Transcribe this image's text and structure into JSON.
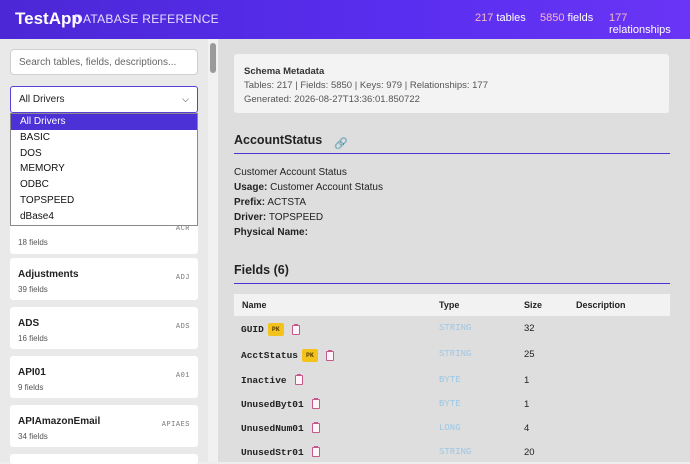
{
  "header": {
    "title": "TestApp",
    "subtitle": "DATABASE REFERENCE",
    "stats": [
      {
        "num": "217",
        "label": "tables"
      },
      {
        "num": "5850",
        "label": "fields"
      },
      {
        "num": "177",
        "label": "relationships"
      }
    ]
  },
  "sidebar": {
    "search_placeholder": "Search tables, fields, descriptions...",
    "driver_selected": "All Drivers",
    "driver_options": [
      "All Drivers",
      "BASIC",
      "DOS",
      "MEMORY",
      "ODBC",
      "TOPSPEED",
      "dBase4"
    ],
    "partial_card_count": "18 fields",
    "partial_card_prefix": "ACR",
    "cards": [
      {
        "name": "Adjustments",
        "count": "39 fields",
        "prefix": "ADJ"
      },
      {
        "name": "ADS",
        "count": "16 fields",
        "prefix": "ADS"
      },
      {
        "name": "API01",
        "count": "9 fields",
        "prefix": "A01"
      },
      {
        "name": "APIAmazonEmail",
        "count": "34 fields",
        "prefix": "APIAES"
      }
    ]
  },
  "meta": {
    "title": "Schema Metadata",
    "line1": "Tables: 217 | Fields: 5850 | Keys: 979 | Relationships: 177",
    "line2": "Generated: 2026-08-27T13:36:01.850722"
  },
  "table": {
    "name": "AccountStatus",
    "description": "Customer Account Status",
    "usage_label": "Usage:",
    "usage": "Customer Account Status",
    "prefix_label": "Prefix:",
    "prefix": "ACTSTA",
    "driver_label": "Driver:",
    "driver": "TOPSPEED",
    "physical_label": "Physical Name:",
    "physical": ""
  },
  "fields": {
    "heading": "Fields (6)",
    "columns": [
      "Name",
      "Type",
      "Size",
      "Description"
    ],
    "pk_label": "PK",
    "rows": [
      {
        "name": "GUID",
        "pk": true,
        "type": "STRING",
        "size": "32"
      },
      {
        "name": "AcctStatus",
        "pk": true,
        "type": "STRING",
        "size": "25"
      },
      {
        "name": "Inactive",
        "pk": false,
        "type": "BYTE",
        "size": "1"
      },
      {
        "name": "UnusedByt01",
        "pk": false,
        "type": "BYTE",
        "size": "1"
      },
      {
        "name": "UnusedNum01",
        "pk": false,
        "type": "LONG",
        "size": "4"
      },
      {
        "name": "UnusedStr01",
        "pk": false,
        "type": "STRING",
        "size": "20"
      }
    ]
  }
}
